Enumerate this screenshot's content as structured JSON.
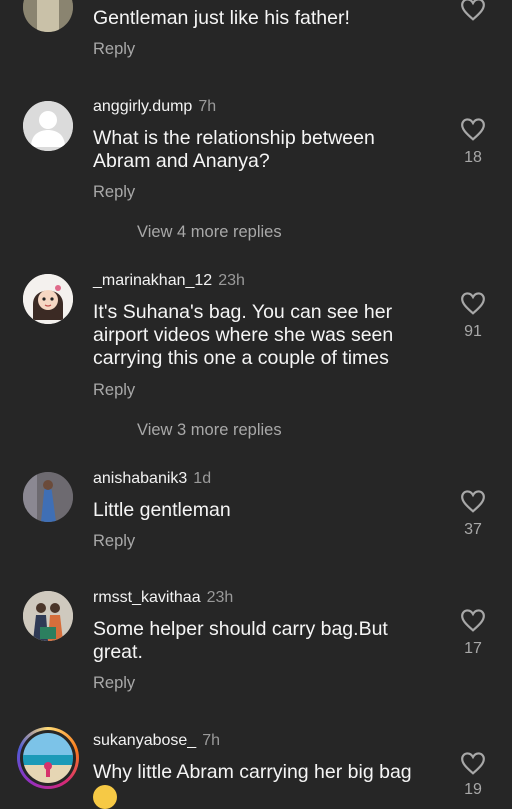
{
  "reply_label": "Reply",
  "comments": [
    {
      "username": "",
      "time": "",
      "text": "Gentleman just like his father!",
      "likes": ""
    },
    {
      "username": "anggirly.dump",
      "time": "7h",
      "text": "What is the relationship between Abram and Ananya?",
      "likes": "18",
      "view_more": "View 4 more replies"
    },
    {
      "username": "_marinakhan_12",
      "time": "23h",
      "text": "It's Suhana's bag. You can see her airport videos where she was seen carrying this one a couple of times",
      "likes": "91",
      "view_more": "View 3 more replies"
    },
    {
      "username": "anishabanik3",
      "time": "1d",
      "text": "Little gentleman",
      "likes": "37"
    },
    {
      "username": "rmsst_kavithaa",
      "time": "23h",
      "text": "Some helper should carry bag.But great.",
      "likes": "17"
    },
    {
      "username": "sukanyabose_",
      "time": "7h",
      "text": "Why little Abram carrying her big bag",
      "likes": "19"
    }
  ],
  "icons": {
    "like": "heart-outline-icon",
    "emoji": "smiling-face-emoji"
  },
  "colors": {
    "background": "#262626",
    "muted": "#a8a8a8"
  }
}
